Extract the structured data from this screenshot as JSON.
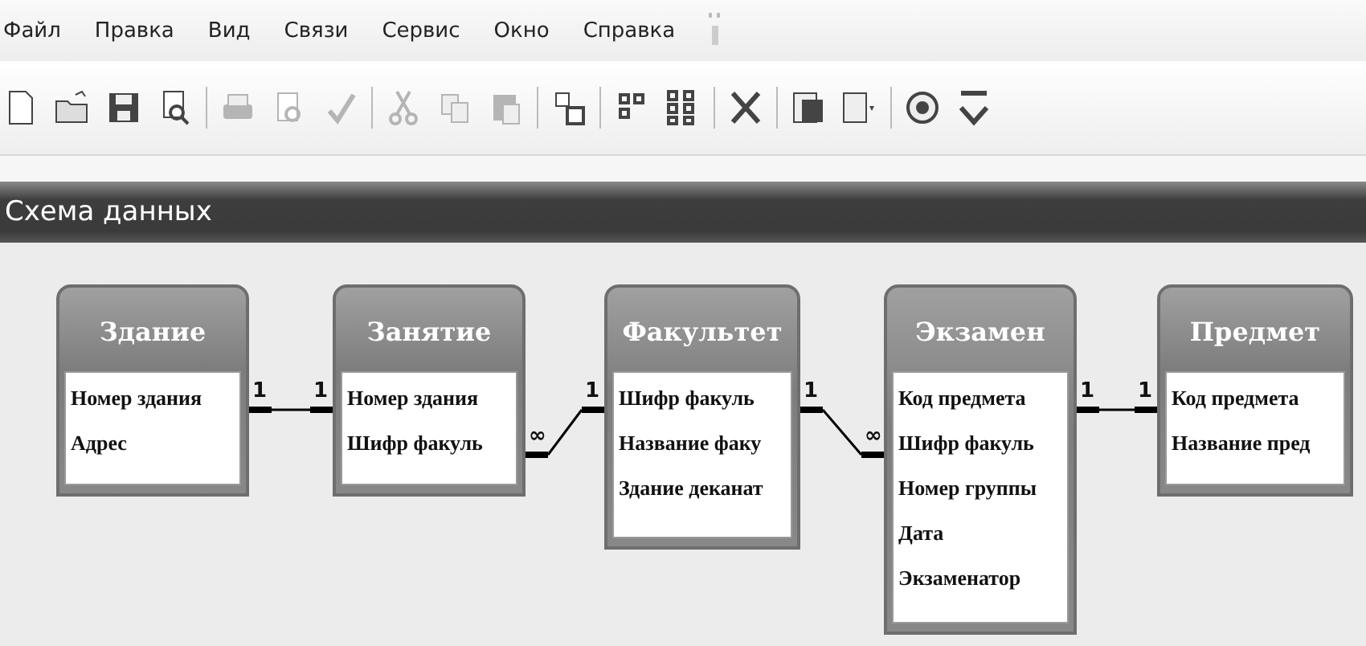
{
  "menu": [
    "Файл",
    "Правка",
    "Вид",
    "Связи",
    "Сервис",
    "Окно",
    "Справка"
  ],
  "toolbar": [
    {
      "kind": "new",
      "disabled": false
    },
    {
      "kind": "open",
      "disabled": false
    },
    {
      "kind": "save",
      "disabled": false
    },
    {
      "kind": "find",
      "disabled": false
    },
    {
      "kind": "sep"
    },
    {
      "kind": "print",
      "disabled": true
    },
    {
      "kind": "preview",
      "disabled": true
    },
    {
      "kind": "spelling",
      "disabled": true
    },
    {
      "kind": "sep"
    },
    {
      "kind": "cut",
      "disabled": true
    },
    {
      "kind": "copy",
      "disabled": true
    },
    {
      "kind": "paste",
      "disabled": true
    },
    {
      "kind": "sep"
    },
    {
      "kind": "show-table",
      "disabled": false
    },
    {
      "kind": "sep"
    },
    {
      "kind": "direct-relations",
      "disabled": false
    },
    {
      "kind": "all-relations",
      "disabled": false
    },
    {
      "kind": "sep"
    },
    {
      "kind": "delete",
      "disabled": false
    },
    {
      "kind": "sep"
    },
    {
      "kind": "properties",
      "disabled": false
    },
    {
      "kind": "new-object",
      "disabled": false
    },
    {
      "kind": "sep"
    },
    {
      "kind": "help",
      "disabled": false
    },
    {
      "kind": "overflow",
      "disabled": false
    }
  ],
  "window": {
    "title": "Схема данных"
  },
  "tables": [
    {
      "name": "Здание",
      "fields": [
        "Номер здания",
        "Адрес"
      ]
    },
    {
      "name": "Занятие",
      "fields": [
        "Номер здания",
        "Шифр факуль"
      ]
    },
    {
      "name": "Факультет",
      "fields": [
        "Шифр факуль",
        "Название факу",
        "Здание деканат"
      ]
    },
    {
      "name": "Экзамен",
      "fields": [
        "Код предмета",
        "Шифр факуль",
        "Номер группы",
        "Дата",
        "Экзаменатор"
      ]
    },
    {
      "name": "Предмет",
      "fields": [
        "Код предмета",
        "Название пред"
      ]
    }
  ],
  "relations": [
    {
      "from_label": "1",
      "to_label": "1"
    },
    {
      "from_label": "∞",
      "to_label": "1"
    },
    {
      "from_label": "1",
      "to_label": "∞"
    },
    {
      "from_label": "1",
      "to_label": "1"
    }
  ]
}
